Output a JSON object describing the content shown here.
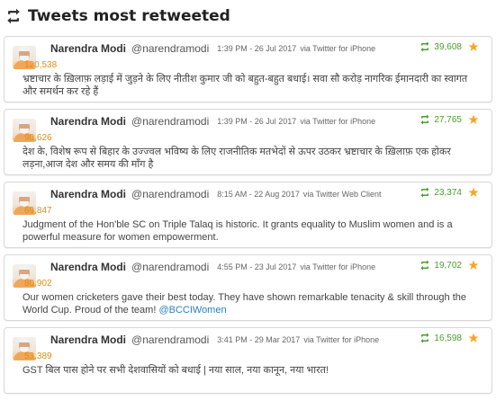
{
  "header": {
    "title": "Tweets most retweeted"
  },
  "tweets": [
    {
      "name": "Narendra Modi",
      "handle": "@narendramodi",
      "time": "1:39 PM - 26 Jul 2017",
      "source": "via Twitter for iPhone",
      "retweets": "39,608",
      "favorites": "120,538",
      "text": "भ्रष्टाचार के ख़िलाफ़ लड़ाई में जुड़ने के लिए नीतीश कुमार जी को बहुत-बहुत बधाई। सवा सौ करोड़ नागरिक ईमानदारी का स्वागत और समर्थन कर रहे हैं",
      "mention": ""
    },
    {
      "name": "Narendra Modi",
      "handle": "@narendramodi",
      "time": "1:39 PM - 26 Jul 2017",
      "source": "via Twitter for iPhone",
      "retweets": "27,765",
      "favorites": "90,626",
      "text": "देश के, विशेष रूप से बिहार के उज्ज्वल भविष्य के लिए राजनीतिक मतभेदों से ऊपर उठकर भ्रष्टाचार के ख़िलाफ़ एक होकर लड़ना,आज देश और समय की माँग है",
      "mention": ""
    },
    {
      "name": "Narendra Modi",
      "handle": "@narendramodi",
      "time": "8:15 AM - 22 Aug 2017",
      "source": "via Twitter Web Client",
      "retweets": "23,374",
      "favorites": "69,847",
      "text": "Judgment of the Hon'ble SC on Triple Talaq is historic. It grants equality to Muslim women and is a powerful measure for women empowerment.",
      "mention": ""
    },
    {
      "name": "Narendra Modi",
      "handle": "@narendramodi",
      "time": "4:55 PM - 23 Jul 2017",
      "source": "via Twitter for iPhone",
      "retweets": "19,702",
      "favorites": "80,902",
      "text": "Our women cricketers gave their best today. They have shown remarkable tenacity & skill through the World Cup. Proud of the team! ",
      "mention": "@BCCIWomen"
    },
    {
      "name": "Narendra Modi",
      "handle": "@narendramodi",
      "time": "3:41 PM - 29 Mar 2017",
      "source": "via Twitter for iPhone",
      "retweets": "16,598",
      "favorites": "53,389",
      "text": "GST बिल पास होने पर सभी देशवासियों को बधाई | नया साल, नया कानून, नया भारत!",
      "mention": ""
    }
  ],
  "colors": {
    "retweet": "#4a9e2b",
    "favorite": "#e08d1a",
    "star": "#f5a623",
    "mention": "#2a7fc2"
  }
}
